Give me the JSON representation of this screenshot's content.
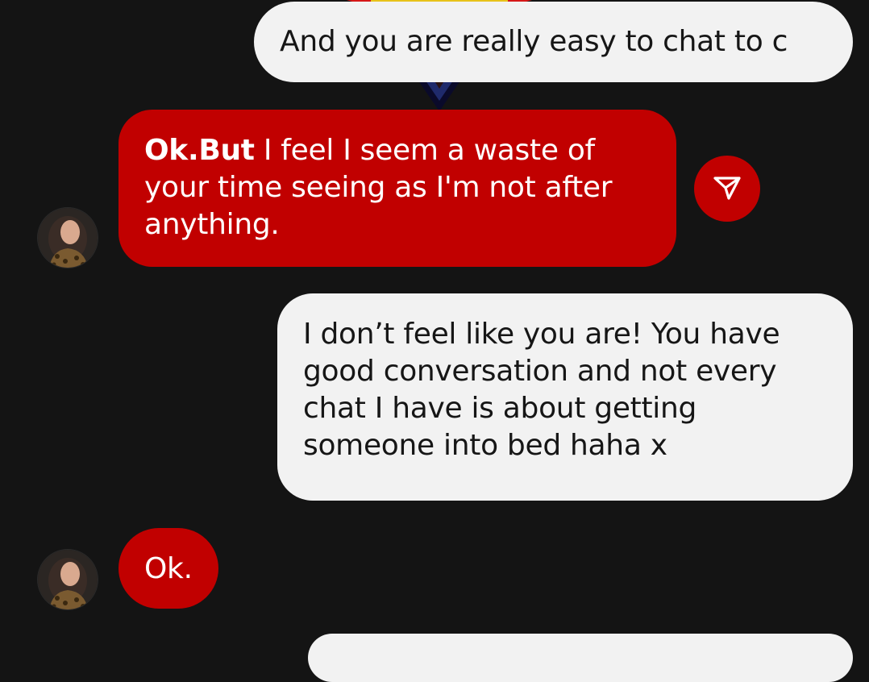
{
  "colors": {
    "background": "#141414",
    "incoming_bubble": "#c10000",
    "outgoing_bubble": "#f2f2f2"
  },
  "messages": [
    {
      "direction": "outgoing",
      "text": "And you are really easy to chat to c"
    },
    {
      "direction": "incoming",
      "bold_prefix": "Ok.But",
      "text": " I feel I  seem a waste of your time seeing as I'm not after anything."
    },
    {
      "direction": "outgoing",
      "text": "I don’t feel like you are! You have good conversation and not every chat I have is about getting someone into bed haha x"
    },
    {
      "direction": "incoming",
      "text": "Ok."
    }
  ],
  "icons": {
    "send_icon": "paper-plane-icon",
    "avatar": "contact-avatar"
  }
}
